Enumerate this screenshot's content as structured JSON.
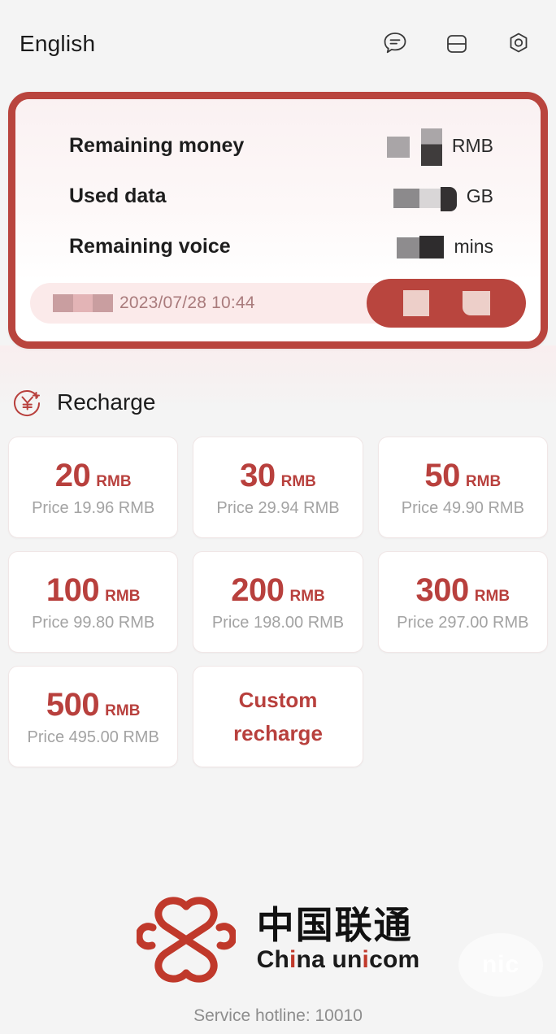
{
  "header": {
    "language_label": "English",
    "icons": [
      {
        "name": "chat-bubble-icon",
        "label": "Customer service chat"
      },
      {
        "name": "sim-card-icon",
        "label": "My card"
      },
      {
        "name": "hexagon-settings-icon",
        "label": "Settings"
      }
    ]
  },
  "account_card": {
    "rows": [
      {
        "label": "Remaining money",
        "value": "",
        "unit": "RMB",
        "redacted": true
      },
      {
        "label": "Used data",
        "value": "",
        "unit": "GB",
        "redacted": true
      },
      {
        "label": "Remaining voice",
        "value": "",
        "unit": "mins",
        "redacted": true
      }
    ],
    "updated_prefix": "",
    "updated_time": "2023/07/28 10:44",
    "action_button_label": ""
  },
  "recharge": {
    "section_title": "Recharge",
    "section_icon": "yuan-plus-icon",
    "price_prefix": "Price",
    "currency": "RMB",
    "options": [
      {
        "amount": "20",
        "currency": "RMB",
        "price_text": "Price 19.96 RMB"
      },
      {
        "amount": "30",
        "currency": "RMB",
        "price_text": "Price 29.94 RMB"
      },
      {
        "amount": "50",
        "currency": "RMB",
        "price_text": "Price 49.90 RMB"
      },
      {
        "amount": "100",
        "currency": "RMB",
        "price_text": "Price 99.80 RMB"
      },
      {
        "amount": "200",
        "currency": "RMB",
        "price_text": "Price 198.00 RMB"
      },
      {
        "amount": "300",
        "currency": "RMB",
        "price_text": "Price 297.00 RMB"
      },
      {
        "amount": "500",
        "currency": "RMB",
        "price_text": "Price 495.00 RMB"
      }
    ],
    "custom_label": "Custom recharge"
  },
  "footer": {
    "brand_cn": "中国联通",
    "brand_en_parts": {
      "a": "Ch",
      "i1": "i",
      "b": "na un",
      "i2": "i",
      "c": "com"
    },
    "brand_en": "China unicom",
    "hotline": "Service hotline: 10010",
    "watermark": "nic"
  },
  "colors": {
    "brand_red": "#b8403d",
    "card_border_red": "#b9453e",
    "page_bg": "#f4f4f4",
    "muted_text": "#a3a3a3"
  }
}
